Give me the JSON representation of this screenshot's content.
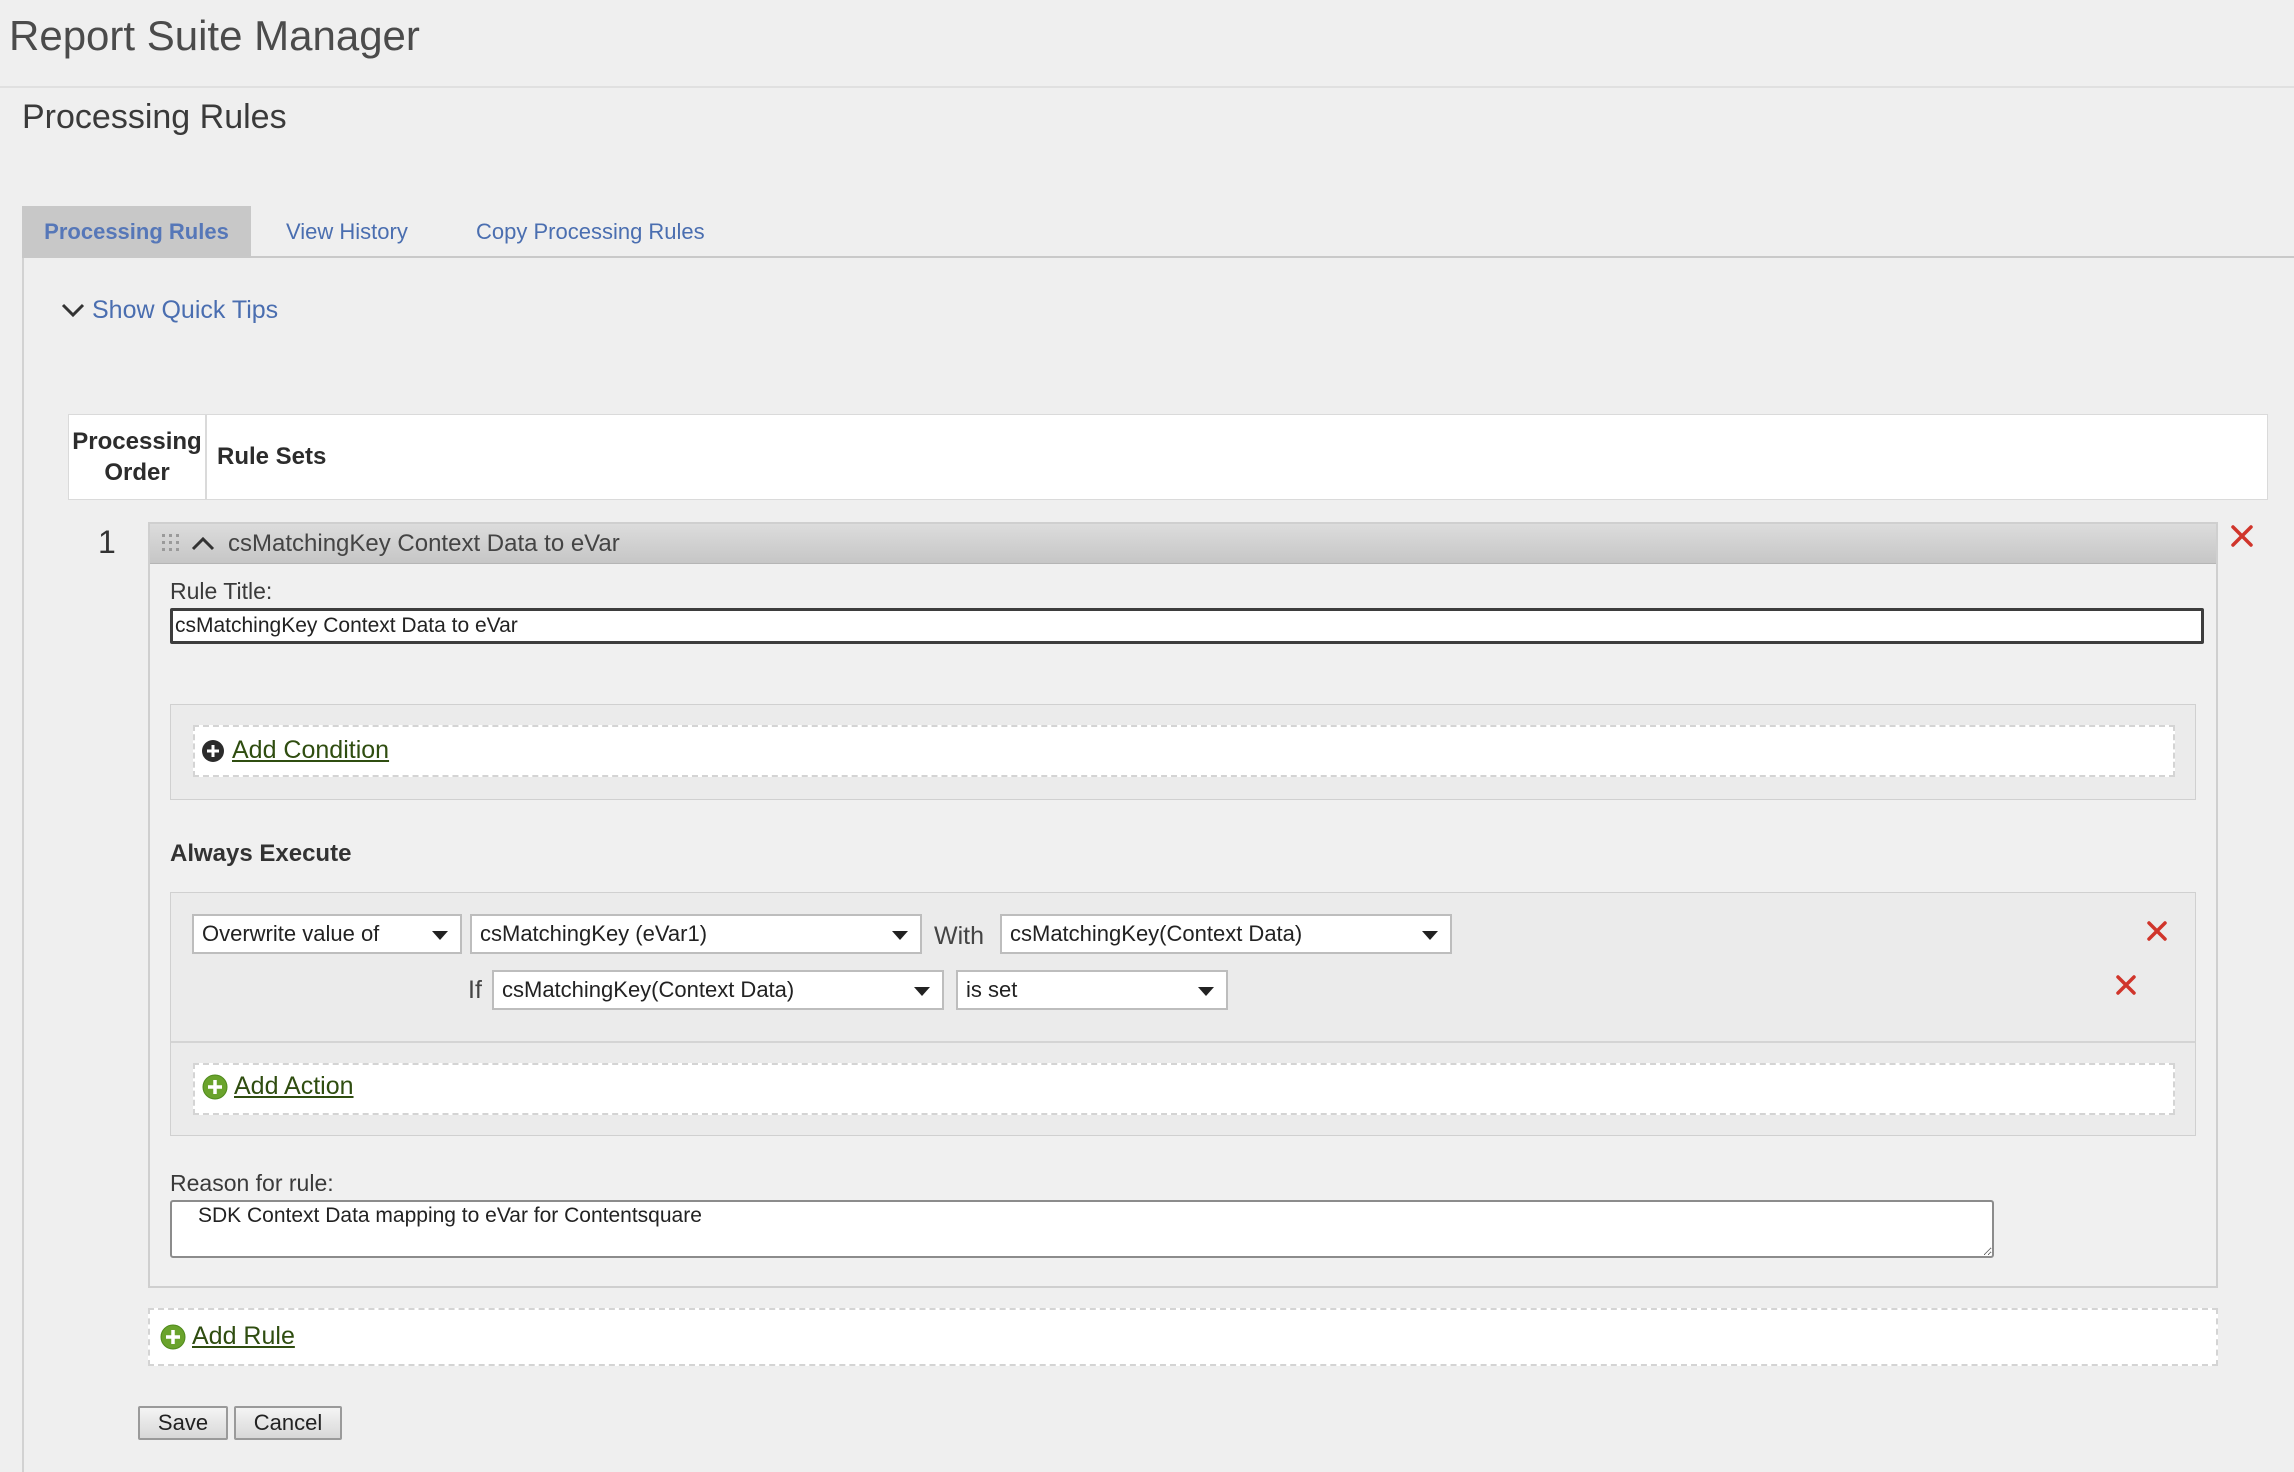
{
  "app": {
    "title": "Report Suite Manager"
  },
  "page": {
    "title": "Processing Rules"
  },
  "tabs": [
    {
      "label": "Processing Rules",
      "active": true
    },
    {
      "label": "View History",
      "active": false
    },
    {
      "label": "Copy Processing Rules",
      "active": false
    }
  ],
  "quick_tips": {
    "label": "Show Quick Tips"
  },
  "table": {
    "col_order": "Processing Order",
    "col_rules": "Rule Sets"
  },
  "rule": {
    "order": "1",
    "header_title": "csMatchingKey Context Data to eVar",
    "title_label": "Rule Title:",
    "title_value": "csMatchingKey Context Data to eVar",
    "add_condition": "Add Condition",
    "always_execute": "Always Execute",
    "action": {
      "operation": "Overwrite value of",
      "target": "csMatchingKey (eVar1)",
      "with_label": "With",
      "source": "csMatchingKey(Context Data)",
      "if_label": "If",
      "if_field": "csMatchingKey(Context Data)",
      "if_condition": "is set"
    },
    "add_action": "Add Action",
    "reason_label": "Reason for rule:",
    "reason_value": "SDK Context Data mapping to eVar for Contentsquare"
  },
  "add_rule": "Add Rule",
  "buttons": {
    "save": "Save",
    "cancel": "Cancel"
  },
  "colors": {
    "link": "#4a6eb0",
    "add_link": "#2f4d10",
    "add_icon": "#6aa32c",
    "delete": "#d0352b"
  },
  "icons": [
    "chevron-down-icon",
    "grip-icon",
    "chevron-up-icon",
    "close-icon",
    "plus-circle-icon"
  ]
}
